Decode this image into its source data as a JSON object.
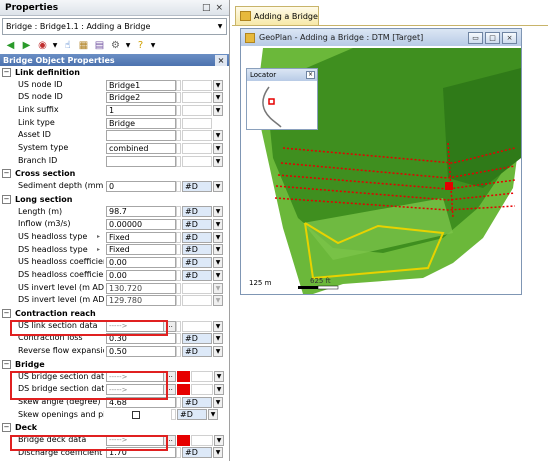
{
  "properties": {
    "title": "Properties",
    "title_controls": [
      "□",
      "×"
    ],
    "object_combo": "Bridge : Bridge1.1 : Adding a Bridge",
    "toolbar_icons": [
      "back-icon",
      "forward-icon",
      "target-icon",
      "hand-icon",
      "grid-icon",
      "paste-icon",
      "settings-icon",
      "help-icon"
    ],
    "object_header": "Bridge Object Properties",
    "sections": {
      "link_definition": "Link definition",
      "cross_section": "Cross section",
      "long_section": "Long section",
      "contraction_reach": "Contraction reach",
      "bridge": "Bridge",
      "deck": "Deck"
    },
    "rows": {
      "us_node": {
        "label": "US node ID",
        "value": "Bridge1"
      },
      "ds_node": {
        "label": "DS node ID",
        "value": "Bridge2"
      },
      "link_suffix": {
        "label": "Link suffix",
        "value": "1"
      },
      "link_type": {
        "label": "Link type",
        "value": "Bridge"
      },
      "asset_id": {
        "label": "Asset ID",
        "value": ""
      },
      "system_type": {
        "label": "System type",
        "value": "combined"
      },
      "branch_id": {
        "label": "Branch ID",
        "value": ""
      },
      "sediment": {
        "label": "Sediment depth (mm)",
        "value": "0",
        "unit": "#D"
      },
      "length": {
        "label": "Length (m)",
        "value": "98.7",
        "unit": "#D"
      },
      "inflow": {
        "label": "Inflow (m3/s)",
        "value": "0.00000",
        "unit": "#D"
      },
      "us_headloss_type": {
        "label": "US headloss type",
        "value": "Fixed",
        "unit": "#D"
      },
      "ds_headloss_type": {
        "label": "DS headloss type",
        "value": "Fixed",
        "unit": "#D"
      },
      "us_headloss_coef": {
        "label": "US headloss coefficient",
        "value": "0.00",
        "unit": "#D"
      },
      "ds_headloss_coef": {
        "label": "DS headloss coefficient",
        "value": "0.00",
        "unit": "#D"
      },
      "us_invert": {
        "label": "US invert level (m AD)",
        "value": "130.720"
      },
      "ds_invert": {
        "label": "DS invert level (m AD)",
        "value": "129.780"
      },
      "us_link_section": {
        "label": "US link section data",
        "value": "----->"
      },
      "contraction_loss": {
        "label": "Contraction loss",
        "value": "0.30",
        "unit": "#D"
      },
      "reverse_flow": {
        "label": "Reverse flow expansion",
        "value": "0.50",
        "unit": "#D"
      },
      "us_bridge_section": {
        "label": "US bridge section data",
        "value": "----->"
      },
      "ds_bridge_section": {
        "label": "DS bridge section data",
        "value": "----->"
      },
      "skew_angle": {
        "label": "Skew angle (degree)",
        "value": "4.68",
        "unit": "#D"
      },
      "skew_openings": {
        "label": "Skew openings and piers",
        "value": "",
        "unit": "#D"
      },
      "bridge_deck": {
        "label": "Bridge deck data",
        "value": "----->"
      },
      "discharge": {
        "label": "Discharge coefficient",
        "value": "1.70",
        "unit": "#D"
      }
    },
    "ellipsis": "...",
    "dropdown_glyph": "▼",
    "toggle_minus": "−",
    "sub_glyph": "▸"
  },
  "tab": {
    "label": "Adding a Bridge"
  },
  "geoplan": {
    "title": "GeoPlan - Adding a Bridge : DTM  [Target]",
    "buttons": [
      "▭",
      "□",
      "×"
    ],
    "locator_title": "Locator",
    "locator_close": "×",
    "scale_left": "125 m",
    "scale_mid": "625 ft"
  },
  "colors": {
    "terrain_dark": "#3f8f1f",
    "terrain_light": "#6bb83a",
    "network_red": "#e60000",
    "highlight_yellow": "#e8d200"
  }
}
